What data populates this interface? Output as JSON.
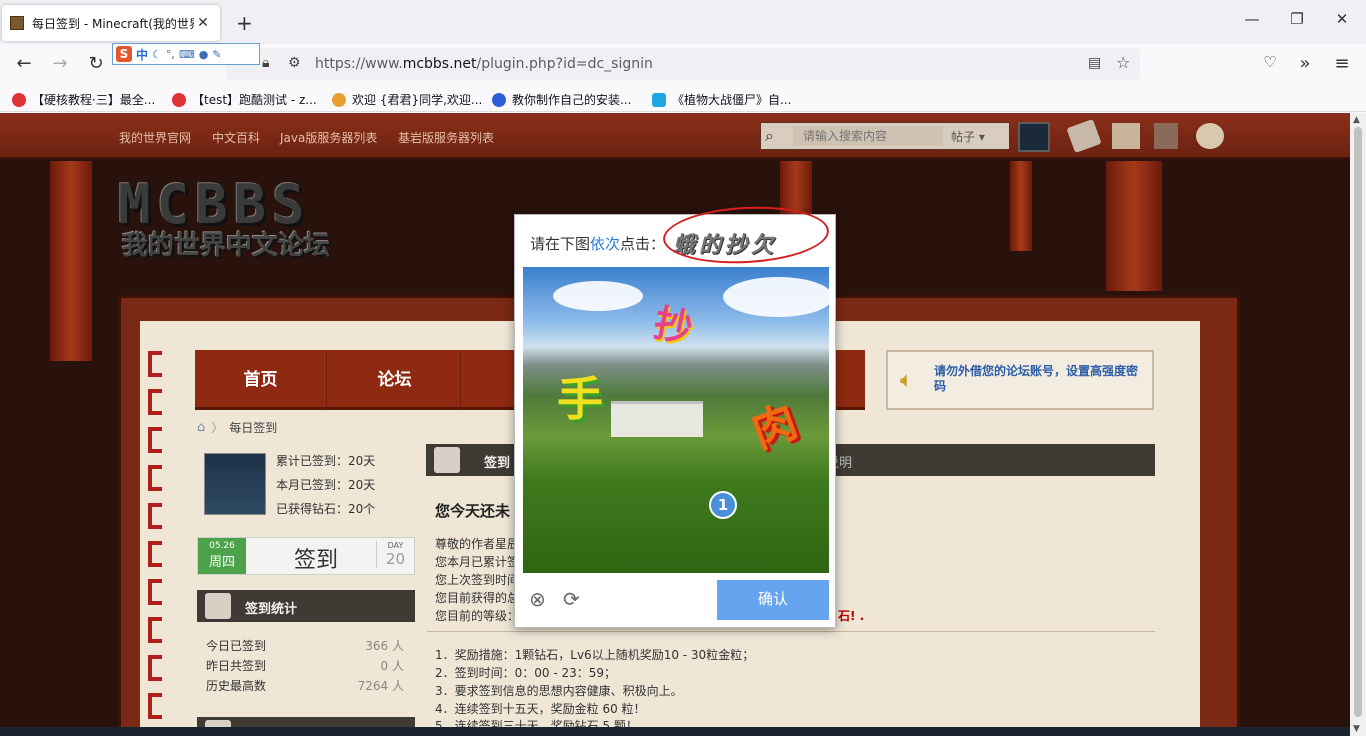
{
  "browser": {
    "tab_title": "每日签到 - Minecraft(我的世界",
    "tab_close": "✕",
    "new_tab": "+",
    "win_min": "—",
    "win_max": "❐",
    "win_close": "✕",
    "url_prefix": "https://www.",
    "url_domain": "mcbbs.net",
    "url_path": "/plugin.php?id=dc_signin",
    "nav_back": "←",
    "nav_forward": "→",
    "nav_reload": "↻",
    "bookmarks": [
      "【硬核教程·三】最全...",
      "【test】跑酷测试 - z...",
      "欢迎 {君君}同学,欢迎...",
      "教你制作自己的安装...",
      "《植物大战僵尸》自..."
    ],
    "ime": {
      "logo": "S",
      "mode": "中",
      "moon": "☾",
      "punct": "°,",
      "kbd": "⌨",
      "user": "●",
      "tool": "✎"
    }
  },
  "site": {
    "top_links": [
      "我的世界官网",
      "中文百科",
      "Java版服务器列表",
      "基岩版服务器列表"
    ],
    "search_placeholder": "请输入搜索内容",
    "search_scope": "帖子 ▾",
    "logo_main": "MCBBS",
    "logo_sub": "我的世界中文论坛",
    "main_nav": [
      "首页",
      "论坛"
    ],
    "notice": "请勿外借您的论坛账号，设置高强度密码",
    "breadcrumb": [
      "⌂",
      "〉",
      "每日签到"
    ],
    "profile_stats": [
      "累计已签到：20天",
      "本月已签到：20天",
      "已获得钻石：20个"
    ],
    "checkin": {
      "date": "05.26",
      "weekday": "周四",
      "label": "签到",
      "day_label": "DAY",
      "day_num": "20"
    },
    "section_stats_title": "签到统计",
    "section_signin_title": "签到",
    "section_rules_tail": "说明",
    "stats": [
      {
        "label": "今日已签到",
        "value": "366 人"
      },
      {
        "label": "昨日共签到",
        "value": "0 人"
      },
      {
        "label": "历史最高数",
        "value": "7264 人"
      }
    ],
    "welcome": "您今天还未",
    "info_lines": [
      "尊敬的作者星辰",
      "您本月已累计签",
      "您上次签到时间",
      "您目前获得的总",
      "您目前的等级："
    ],
    "info_tail": "石!  .",
    "rules": [
      "1．奖励措施：1颗钻石，Lv6以上随机奖励10 - 30粒金粒；",
      "2．签到时间：0：00 - 23：59；",
      "3．要求签到信息的思想内容健康、积极向上。",
      "4．连续签到十五天，奖励金粒 60 粒！",
      "5．连续签到三十天，奖励钻石 5 颗！"
    ]
  },
  "captcha": {
    "prompt_before": "请在下图",
    "prompt_highlight": "依次",
    "prompt_after": "点击：",
    "target_chars": "蛾的抄欠",
    "image_chars": [
      "抄",
      "手",
      "肉"
    ],
    "marker": "1",
    "close_icon": "⊗",
    "refresh_icon": "⟳",
    "confirm_label": "确认"
  }
}
